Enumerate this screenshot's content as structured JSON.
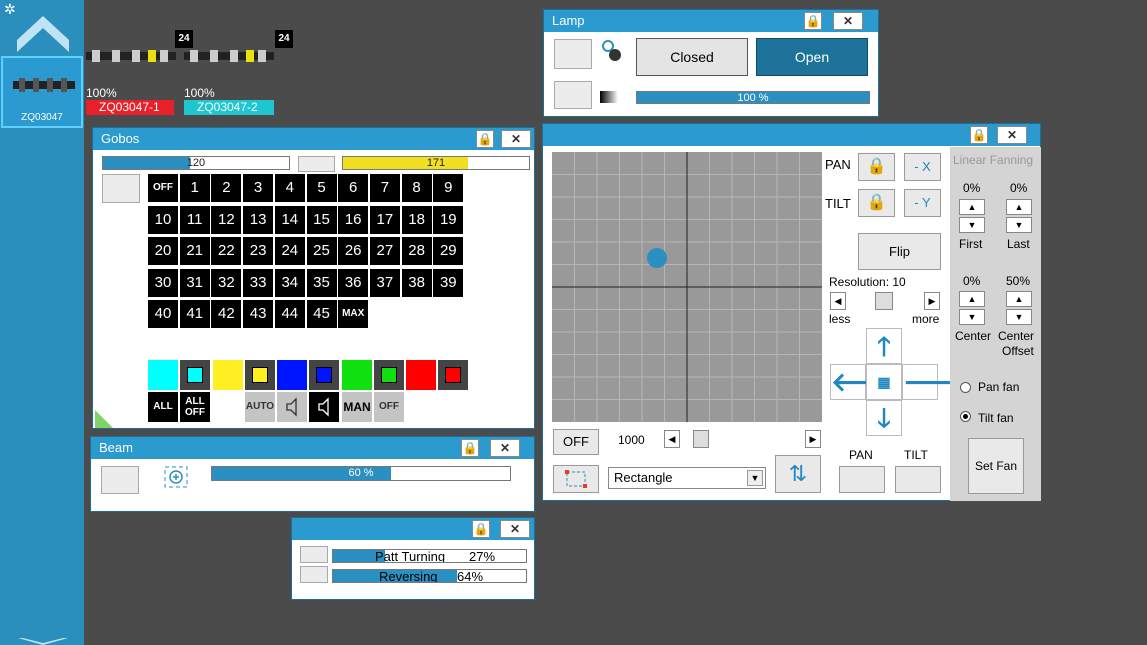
{
  "sidebar": {
    "gear_icon": "gear-icon",
    "fixture_tile_label": "ZQ03047"
  },
  "fixtures": [
    {
      "badge": "24",
      "level": "100%",
      "name": "ZQ03047-1",
      "color": "#e8202a"
    },
    {
      "badge": "24",
      "level": "100%",
      "name": "ZQ03047-2",
      "color": "#1ec7cf"
    }
  ],
  "lamp": {
    "title": "Lamp",
    "closed_label": "Closed",
    "open_label": "Open",
    "dimmer_label": "100 %",
    "dimmer_value": 1.0
  },
  "gobos": {
    "title": "Gobos",
    "bar1_label": "120",
    "bar1_value": 0.47,
    "bar2_label": "171",
    "bar2_value": 0.67,
    "bar2_color": "#f0e020",
    "grid": [
      "OFF",
      "1",
      "2",
      "3",
      "4",
      "5",
      "6",
      "7",
      "8",
      "9",
      "10",
      "11",
      "12",
      "13",
      "14",
      "15",
      "16",
      "17",
      "18",
      "19",
      "20",
      "21",
      "22",
      "23",
      "24",
      "25",
      "26",
      "27",
      "28",
      "29",
      "30",
      "31",
      "32",
      "33",
      "34",
      "35",
      "36",
      "37",
      "38",
      "39",
      "40",
      "41",
      "42",
      "43",
      "44",
      "45",
      "MAX"
    ],
    "colors": [
      "#00ffff",
      "#ffee22",
      "#0015ff",
      "#10e010",
      "#ff0000"
    ],
    "all_label": "ALL",
    "all_off_label": "ALL OFF",
    "auto_label": "AUTO",
    "man_label": "MAN",
    "off_label": "OFF"
  },
  "beam": {
    "title": "Beam",
    "bar_label": "60 %",
    "bar_value": 0.6
  },
  "pattern": {
    "rows": [
      {
        "label": "Patt Turning",
        "value_label": "27%",
        "value": 0.27
      },
      {
        "label": "Reversing",
        "value_label": "64%",
        "value": 0.64
      }
    ]
  },
  "pantilt": {
    "pan_label": "PAN",
    "tilt_label": "TILT",
    "minus_x_label": "- X",
    "minus_y_label": "- Y",
    "flip_label": "Flip",
    "resolution_label": "Resolution: 10",
    "less_label": "less",
    "more_label": "more",
    "off_label": "OFF",
    "speed_value": "1000",
    "shape_select": "Rectangle",
    "bottom_pan_label": "PAN",
    "bottom_tilt_label": "TILT"
  },
  "fanning": {
    "title": "Linear Fanning",
    "first_value": "0%",
    "last_value": "0%",
    "first_label": "First",
    "last_label": "Last",
    "center_value": "0%",
    "center_offset_value": "50%",
    "center_label": "Center",
    "center_offset_label_1": "Center",
    "center_offset_label_2": "Offset",
    "pan_fan_label": "Pan fan",
    "tilt_fan_label": "Tilt fan",
    "set_fan_label": "Set Fan"
  },
  "colors": {
    "accent": "#2a9acf",
    "fill": "#2a8fc1",
    "background": "#4b4b4b"
  }
}
